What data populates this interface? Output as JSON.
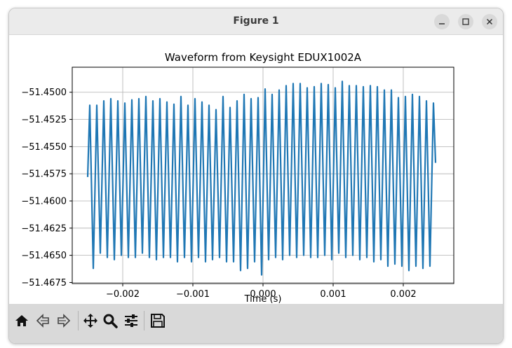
{
  "window": {
    "title": "Figure 1",
    "controls": [
      "minimize-icon",
      "maximize-icon",
      "close-icon"
    ]
  },
  "toolbar": {
    "buttons": [
      "home-icon",
      "back-icon",
      "forward-icon",
      "pan-icon",
      "zoom-icon",
      "configure-subplots-icon",
      "save-icon"
    ]
  },
  "chart_data": {
    "type": "line",
    "title": "Waveform from Keysight EDUX1002A",
    "xlabel": "Time (s)",
    "ylabel": "",
    "xlim": [
      -0.00272,
      0.00272
    ],
    "ylim": [
      -51.4676,
      -51.4477
    ],
    "xticks": [
      -0.002,
      -0.001,
      0.0,
      0.001,
      0.002
    ],
    "xtick_labels": [
      "−0.002",
      "−0.001",
      "0.000",
      "0.001",
      "0.002"
    ],
    "yticks": [
      -51.45,
      -51.4525,
      -51.455,
      -51.4575,
      -51.46,
      -51.4625,
      -51.465,
      -51.4675
    ],
    "ytick_labels": [
      "−51.4500",
      "−51.4525",
      "−51.4550",
      "−51.4575",
      "−51.4600",
      "−51.4625",
      "−51.4650",
      "−51.4675"
    ],
    "grid": true,
    "series_color": "#1f77b4",
    "series": [
      {
        "x": [
          -0.0025,
          -0.00247,
          -0.00242,
          -0.00237,
          -0.00232,
          -0.00227,
          -0.00222,
          -0.00217,
          -0.00212,
          -0.00207,
          -0.00202,
          -0.00197,
          -0.00192,
          -0.00187,
          -0.00182,
          -0.00177,
          -0.00172,
          -0.00167,
          -0.00162,
          -0.00157,
          -0.00152,
          -0.00147,
          -0.00142,
          -0.00137,
          -0.00132,
          -0.00127,
          -0.00122,
          -0.00117,
          -0.00112,
          -0.00107,
          -0.00102,
          -0.00097,
          -0.00092,
          -0.00087,
          -0.00082,
          -0.00077,
          -0.00072,
          -0.00067,
          -0.00062,
          -0.00057,
          -0.00052,
          -0.00047,
          -0.00042,
          -0.00037,
          -0.00032,
          -0.00027,
          -0.00022,
          -0.00017,
          -0.00012,
          -7e-05,
          -2e-05,
          3e-05,
          8e-05,
          0.00013,
          0.00018,
          0.00023,
          0.00028,
          0.00033,
          0.00038,
          0.00043,
          0.00048,
          0.00053,
          0.00058,
          0.00063,
          0.00068,
          0.00073,
          0.00078,
          0.00083,
          0.00088,
          0.00093,
          0.00098,
          0.00103,
          0.00108,
          0.00113,
          0.00118,
          0.00123,
          0.00128,
          0.00133,
          0.00138,
          0.00143,
          0.00148,
          0.00153,
          0.00158,
          0.00163,
          0.00168,
          0.00173,
          0.00178,
          0.00183,
          0.00188,
          0.00193,
          0.00198,
          0.00203,
          0.00208,
          0.00213,
          0.00218,
          0.00223,
          0.00228,
          0.00233,
          0.00238,
          0.00243,
          0.00246
        ],
        "y": [
          -51.4578,
          -51.4512,
          -51.4662,
          -51.4512,
          -51.4648,
          -51.4508,
          -51.4652,
          -51.4506,
          -51.4654,
          -51.4508,
          -51.465,
          -51.451,
          -51.4652,
          -51.4507,
          -51.4652,
          -51.4506,
          -51.4648,
          -51.4504,
          -51.4652,
          -51.4508,
          -51.4654,
          -51.4506,
          -51.4652,
          -51.4509,
          -51.4652,
          -51.4511,
          -51.4656,
          -51.4504,
          -51.4652,
          -51.4512,
          -51.4656,
          -51.4506,
          -51.4652,
          -51.4509,
          -51.4656,
          -51.4512,
          -51.4654,
          -51.4516,
          -51.4652,
          -51.4504,
          -51.4656,
          -51.4514,
          -51.4656,
          -51.4508,
          -51.4664,
          -51.4502,
          -51.4662,
          -51.4506,
          -51.4656,
          -51.4505,
          -51.4668,
          -51.4497,
          -51.4654,
          -51.4502,
          -51.4652,
          -51.4498,
          -51.4654,
          -51.4494,
          -51.465,
          -51.4492,
          -51.4652,
          -51.4492,
          -51.465,
          -51.4496,
          -51.4652,
          -51.4495,
          -51.4652,
          -51.4492,
          -51.465,
          -51.4493,
          -51.4654,
          -51.4496,
          -51.4648,
          -51.449,
          -51.4652,
          -51.4494,
          -51.465,
          -51.4494,
          -51.4654,
          -51.4495,
          -51.4652,
          -51.4494,
          -51.4656,
          -51.4495,
          -51.4654,
          -51.4498,
          -51.466,
          -51.4498,
          -51.4658,
          -51.4505,
          -51.466,
          -51.4504,
          -51.4664,
          -51.4502,
          -51.466,
          -51.4504,
          -51.4662,
          -51.4508,
          -51.466,
          -51.451,
          -51.4565
        ]
      }
    ]
  }
}
